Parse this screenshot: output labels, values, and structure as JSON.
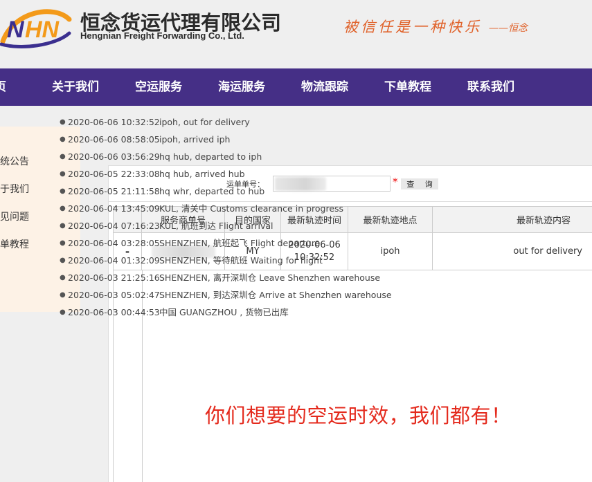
{
  "header": {
    "brand_cn": "恒念货运代理有限公司",
    "brand_en": "Hengnian Freight Forwarding Co., Ltd.",
    "slogan": "被信任是一种快乐",
    "slogan_sign": "——恒念",
    "logo_text": "HN",
    "colors": {
      "logo_purple": "#3b2f8f",
      "logo_orange": "#f39a1a",
      "slogan": "#e0622a"
    }
  },
  "nav": {
    "background": "#452f86",
    "items": [
      {
        "label": "页"
      },
      {
        "label": "关于我们"
      },
      {
        "label": "空运服务"
      },
      {
        "label": "海运服务"
      },
      {
        "label": "物流跟踪"
      },
      {
        "label": "下单教程"
      },
      {
        "label": "联系我们"
      }
    ]
  },
  "sidebar": {
    "items": [
      {
        "label": "统公告"
      },
      {
        "label": "于我们"
      },
      {
        "label": "见问题"
      },
      {
        "label": "单教程"
      }
    ]
  },
  "query": {
    "label": "运单单号：",
    "required_mark": "*",
    "button_label": "查 询"
  },
  "table": {
    "headers": [
      "服务商单号",
      "目的国家",
      "最新轨迹时间",
      "最新轨迹地点",
      "最新轨迹内容"
    ],
    "row": {
      "toggle": "-",
      "country": "MY",
      "latest_time_date": "2020-06-06",
      "latest_time_clock": "10:32:52",
      "latest_location": "ipoh",
      "latest_content": "out for delivery"
    }
  },
  "events": [
    {
      "time": "2020-06-06 10:32:52",
      "desc": "ipoh, out for delivery"
    },
    {
      "time": "2020-06-06 08:58:05",
      "desc": "ipoh, arrived iph"
    },
    {
      "time": "2020-06-06 03:56:29",
      "desc": "hq hub, departed to iph"
    },
    {
      "time": "2020-06-05 22:33:08",
      "desc": "hq hub, arrived hub"
    },
    {
      "time": "2020-06-05 21:11:58",
      "desc": "hq whr, departed to hub"
    },
    {
      "time": "2020-06-04 13:45:09",
      "desc": "KUL, 清关中 Customs clearance in progress"
    },
    {
      "time": "2020-06-04 07:16:23",
      "desc": "KUL, 航班到达 Flight arrival"
    },
    {
      "time": "2020-06-04 03:28:05",
      "desc": "SHENZHEN, 航班起飞 Flight departure"
    },
    {
      "time": "2020-06-04 01:32:09",
      "desc": "SHENZHEN, 等待航班 Waiting for flight"
    },
    {
      "time": "2020-06-03 21:25:16",
      "desc": "SHENZHEN, 离开深圳仓 Leave Shenzhen warehouse"
    },
    {
      "time": "2020-06-03 05:02:47",
      "desc": "SHENZHEN, 到达深圳仓 Arrive at Shenzhen warehouse"
    },
    {
      "time": "2020-06-03 00:44:53",
      "desc": "中国 GUANGZHOU , 货物已出库"
    }
  ],
  "overlay": {
    "caption": "你们想要的空运时效，我们都有！",
    "color": "#e42a1d"
  }
}
